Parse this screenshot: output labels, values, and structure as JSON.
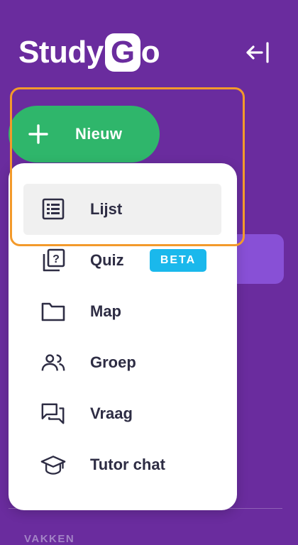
{
  "logo": {
    "prefix": "Study",
    "badge": "G",
    "suffix": "o"
  },
  "sidebar": {
    "collapse_icon": "collapse-left-icon",
    "section_label": "VAKKEN"
  },
  "new_button": {
    "label": "Nieuw",
    "icon": "plus-icon"
  },
  "menu": {
    "items": [
      {
        "label": "Lijst",
        "icon": "list-icon",
        "selected": true
      },
      {
        "label": "Quiz",
        "icon": "quiz-icon",
        "badge": "BETA"
      },
      {
        "label": "Map",
        "icon": "folder-icon"
      },
      {
        "label": "Groep",
        "icon": "group-icon"
      },
      {
        "label": "Vraag",
        "icon": "chat-icon"
      },
      {
        "label": "Tutor chat",
        "icon": "graduation-cap-icon"
      }
    ]
  },
  "colors": {
    "background": "#6a2c9e",
    "new_button": "#2fb66b",
    "beta_badge": "#1ab8ec",
    "highlight": "#f39a2b",
    "selected_item": "#f0f0f0"
  }
}
